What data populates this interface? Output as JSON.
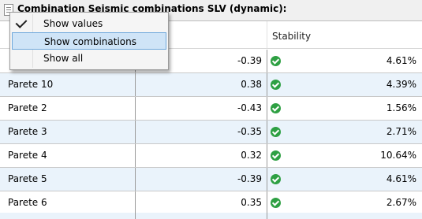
{
  "title": "Combination Seismic combinations SLV (dynamic):",
  "columns": {
    "stability": "Stability"
  },
  "menu": {
    "items": [
      {
        "label": "Show values",
        "checked": true
      },
      {
        "label": "Show combinations",
        "highlighted": true
      },
      {
        "label": "Show all"
      }
    ]
  },
  "rows": [
    {
      "name": "",
      "value": "-0.39",
      "stability": "4.61%"
    },
    {
      "name": "Parete 10",
      "value": "0.38",
      "stability": "4.39%"
    },
    {
      "name": "Parete 2",
      "value": "-0.43",
      "stability": "1.56%"
    },
    {
      "name": "Parete 3",
      "value": "-0.35",
      "stability": "2.71%"
    },
    {
      "name": "Parete 4",
      "value": "0.32",
      "stability": "10.64%"
    },
    {
      "name": "Parete 5",
      "value": "-0.39",
      "stability": "4.61%"
    },
    {
      "name": "Parete 6",
      "value": "0.35",
      "stability": "2.67%"
    }
  ],
  "colors": {
    "alt_row": "#eaf3fb",
    "check": "#2ea043",
    "menu_highlight": "#cfe4f7"
  },
  "icons": {
    "status": "check-circle-icon",
    "title": "document-icon",
    "menu_check": "checkmark-icon"
  }
}
